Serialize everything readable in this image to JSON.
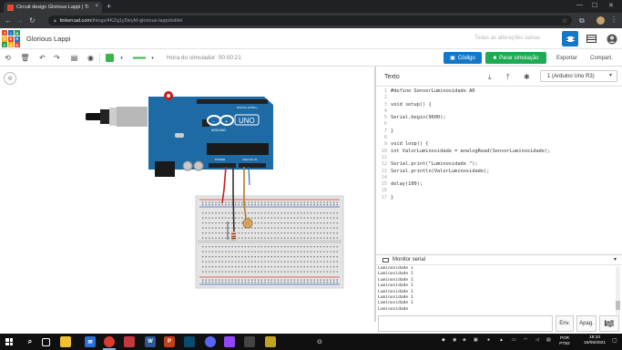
{
  "browser": {
    "tab_title": "Circuit design Glorious Lappi | Ti",
    "tab_close": "×",
    "new_tab": "+",
    "url_host": "tinkercad.com",
    "url_path": "/things/4KZq1y5leyM-glorious-lappi/editel",
    "minimize": "—",
    "maximize": "☐",
    "close": "✕"
  },
  "header": {
    "logo_letters": [
      "TIN",
      "KER",
      "CAD"
    ],
    "logo_colors": [
      "#e8492d",
      "#1577c9",
      "#2a9e4a",
      "#f6b01e",
      "#e8492d",
      "#1577c9",
      "#2a9e4a",
      "#f6b01e",
      "#e8492d"
    ],
    "project_name": "Glorious Lappi",
    "save_status": "Todas as alterações salvas"
  },
  "toolbar": {
    "sim_time_label": "Hora do simulador: 00:00:21",
    "code_label": "Código",
    "simulate_label": "Parar simulação",
    "export_label": "Exportar",
    "share_label": "Compart."
  },
  "code_panel": {
    "mode": "Texto",
    "device": "1 (Arduino Uno R3)",
    "lines": [
      {
        "n": "1",
        "t": "#define SensorLuminosidade A0"
      },
      {
        "n": "2",
        "t": ""
      },
      {
        "n": "3",
        "t": "void setup() {"
      },
      {
        "n": "4",
        "t": ""
      },
      {
        "n": "5",
        "t": "Serial.begin(9600);"
      },
      {
        "n": "6",
        "t": ""
      },
      {
        "n": "7",
        "t": "}"
      },
      {
        "n": "8",
        "t": ""
      },
      {
        "n": "9",
        "t": "void loop() {"
      },
      {
        "n": "10",
        "t": "int ValorLuminosidade = analogRead(SensorLuminosidade);"
      },
      {
        "n": "11",
        "t": ""
      },
      {
        "n": "12",
        "t": "Serial.print(\"Luminosidade \");"
      },
      {
        "n": "13",
        "t": "Serial.println(ValorLuminosidade);"
      },
      {
        "n": "14",
        "t": ""
      },
      {
        "n": "15",
        "t": "delay(100);"
      },
      {
        "n": "16",
        "t": ""
      },
      {
        "n": "17",
        "t": "}"
      }
    ]
  },
  "serial_monitor": {
    "title": "Monitor serial",
    "output": [
      "Luminosidade 1",
      "Luminosidade 1",
      "Luminosidade 1",
      "Luminosidade 1",
      "Luminosidade 1",
      "Luminosidade 1",
      "Luminosidade 1",
      "Luminosidade"
    ],
    "send_label": "Env.",
    "clear_label": "Apag.",
    "input_value": ""
  },
  "arduino": {
    "brand": "ARDUINO",
    "model": "UNO",
    "digital_label": "DIGITAL (PWM~)",
    "power_label": "POWER",
    "analog_label": "ANALOG IN"
  },
  "taskbar": {
    "language": "POR",
    "keyboard": "PTB2",
    "time": "18:10",
    "date": "15/06/2021"
  },
  "colors": {
    "arduino_board": "#1d6aa5",
    "code_button": "#1478c8",
    "simulate_button": "#1faa54"
  }
}
